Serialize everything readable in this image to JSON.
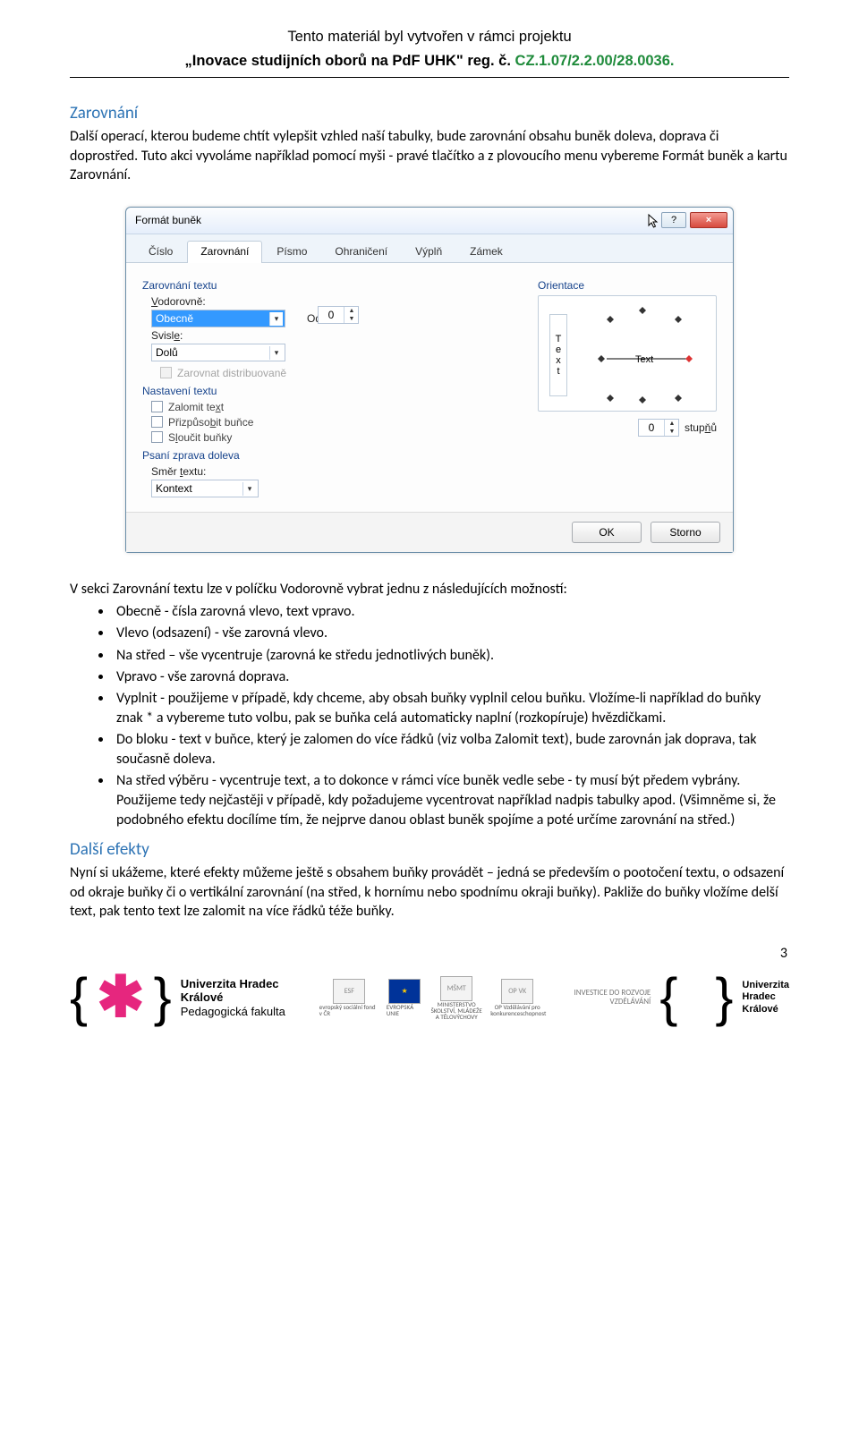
{
  "header": {
    "project_line": "Tento materiál byl vytvořen v rámci projektu",
    "title_prefix": "„Inovace studijních oborů na PdF UHK\" reg. č. ",
    "regnum": "CZ.1.07/2.2.00/28.0036",
    "title_dot": "."
  },
  "section1": {
    "title": "Zarovnání",
    "p1": "Další operací, kterou budeme chtít vylepšit vzhled naší tabulky, bude zarovnání obsahu buněk doleva, doprava či doprostřed. Tuto akci vyvoláme například pomocí myši - pravé tlačítko a z plovoucího menu vybereme Formát buněk a kartu Zarovnání."
  },
  "dialog": {
    "title": "Formát buněk",
    "help_label": "?",
    "close_label": "×",
    "tabs": {
      "t0": "Číslo",
      "t1": "Zarovnání",
      "t2": "Písmo",
      "t3": "Ohraničení",
      "t4": "Výplň",
      "t5": "Zámek"
    },
    "group_zarovnani": "Zarovnání textu",
    "vodorovne_label": "Vodorovně:",
    "vodorovne_value": "Obecně",
    "odsazeni_label": "Odsazení:",
    "odsazeni_value": "0",
    "svisle_label": "Svisle:",
    "svisle_value": "Dolů",
    "zarovnat_distrib": "Zarovnat distribuovaně",
    "group_nastaveni": "Nastavení textu",
    "zalomit": "Zalomit text",
    "prizpusobit": "Přizpůsobit buňce",
    "sloucit": "Sloučit buňky",
    "group_psani": "Psaní zprava doleva",
    "smer_label": "Směr textu:",
    "smer_value": "Kontext",
    "orientace_label": "Orientace",
    "orient_vertical": "Text",
    "orient_label_inside": "Text",
    "stupnu_value": "0",
    "stupnu_label": "stupňů",
    "ok_label": "OK",
    "storno_label": "Storno"
  },
  "list": {
    "intro": "V sekci Zarovnání textu lze v políčku Vodorovně vybrat jednu z následujících možností:",
    "b0": "Obecně - čísla zarovná vlevo, text vpravo.",
    "b1": "Vlevo (odsazení) - vše zarovná vlevo.",
    "b2": "Na střed – vše vycentruje (zarovná ke středu jednotlivých buněk).",
    "b3": "Vpravo - vše zarovná doprava.",
    "b4": "Vyplnit - použijeme v případě, kdy chceme, aby obsah buňky vyplnil celou buňku. Vložíme-li například do buňky znak * a vybereme tuto volbu, pak se buňka celá automaticky naplní (rozkopíruje) hvězdičkami.",
    "b5": "Do bloku - text v buňce, který je zalomen do více řádků (viz volba Zalomit text), bude zarovnán jak doprava, tak současně doleva.",
    "b6": "Na střed výběru - vycentruje text, a to dokonce v rámci více buněk vedle sebe - ty musí být předem vybrány. Použijeme tedy nejčastěji v případě, kdy požadujeme vycentrovat například nadpis tabulky apod. (Všimněme si, že podobného efektu docílíme tím, že nejprve danou oblast buněk spojíme a poté určíme zarovnání na střed.)"
  },
  "section2": {
    "title": "Další efekty",
    "p1": "Nyní si ukážeme, které efekty můžeme ještě s obsahem buňky provádět – jedná se především o pootočení textu, o odsazení od okraje buňky či o vertikální zarovnání (na střed, k hornímu nebo spodnímu okraji buňky). Pakliže do buňky vložíme delší text, pak tento text lze zalomit na více řádků téže buňky."
  },
  "page_number": "3",
  "footer": {
    "uhk_line1": "Univerzita Hradec Králové",
    "uhk_line2": "Pedagogická fakulta",
    "esf_label": "evropský sociální fond v ČR",
    "eu_label": "EVROPSKÁ UNIE",
    "msmt_label": "MINISTERSTVO ŠKOLSTVÍ, MLÁDEŽE A TĚLOVÝCHOVY",
    "opvk_label": "OP Vzdělávání pro konkurenceschopnost",
    "invest": "INVESTICE DO ROZVOJE VZDĚLÁVÁNÍ",
    "uhk_line1b": "Univerzita",
    "uhk_line2b": "Hradec",
    "uhk_line3b": "Králové"
  }
}
